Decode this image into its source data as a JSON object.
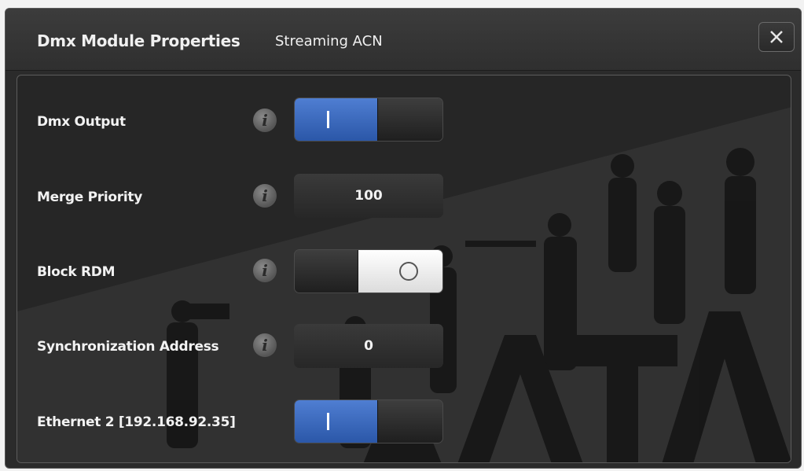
{
  "dialog": {
    "title": "Dmx Module Properties",
    "subtitle": "Streaming ACN",
    "close_icon": "close-icon"
  },
  "rows": [
    {
      "label": "Dmx Output",
      "control": "toggle",
      "state": "on",
      "on_symbol": "|",
      "info_icon": "info-icon"
    },
    {
      "label": "Merge Priority",
      "control": "value",
      "value": "100",
      "info_icon": "info-icon"
    },
    {
      "label": "Block RDM",
      "control": "toggle",
      "state": "off",
      "off_symbol": "O",
      "info_icon": "info-icon"
    },
    {
      "label": "Synchronization Address",
      "control": "value",
      "value": "0",
      "info_icon": "info-icon"
    },
    {
      "label": "Ethernet 2 [192.168.92.35]",
      "control": "toggle",
      "state": "on",
      "on_symbol": "|",
      "info_icon": "info-icon"
    }
  ],
  "colors": {
    "toggle_on": "#3a68bf",
    "panel": "#262626"
  }
}
